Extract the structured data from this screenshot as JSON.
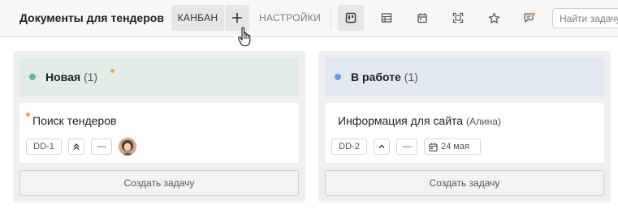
{
  "header": {
    "title": "Документы для тендеров",
    "tab_kanban": "КАНБАН",
    "tab_add": "+",
    "tab_settings": "НАСТРОЙКИ",
    "search_placeholder": "Найти задачу"
  },
  "view_buttons": [
    {
      "icon": "kanban-view-icon",
      "active": true
    },
    {
      "icon": "table-view-icon",
      "active": false
    },
    {
      "icon": "calendar-view-icon",
      "active": false
    },
    {
      "icon": "fullscreen-icon",
      "active": false
    },
    {
      "icon": "star-icon",
      "active": false
    },
    {
      "icon": "chat-icon",
      "active": false
    }
  ],
  "columns": [
    {
      "title": "Новая",
      "count": "(1)",
      "color": "#5fb89a",
      "header_bg": "#e3ede8",
      "cards": [
        {
          "title": "Поиск тендеров",
          "assignee": "",
          "id": "DD-1",
          "priority_icon": "double-chevron-up-icon",
          "status": "—",
          "unread": true
        }
      ],
      "create_label": "Создать задачу"
    },
    {
      "title": "В работе",
      "count": "(1)",
      "color": "#6a9be3",
      "header_bg": "#e2e9f3",
      "cards": [
        {
          "title": "Информация для сайта",
          "assignee": "(Алина)",
          "id": "DD-2",
          "priority_icon": "chevron-up-icon",
          "status": "—",
          "due": "24 мая",
          "unread": false
        }
      ],
      "create_label": "Создать задачу"
    }
  ],
  "colors": {
    "accent_dot": "#f0a04b",
    "topbar_bg": "#f7f7f7",
    "column_bg": "#efefef"
  }
}
